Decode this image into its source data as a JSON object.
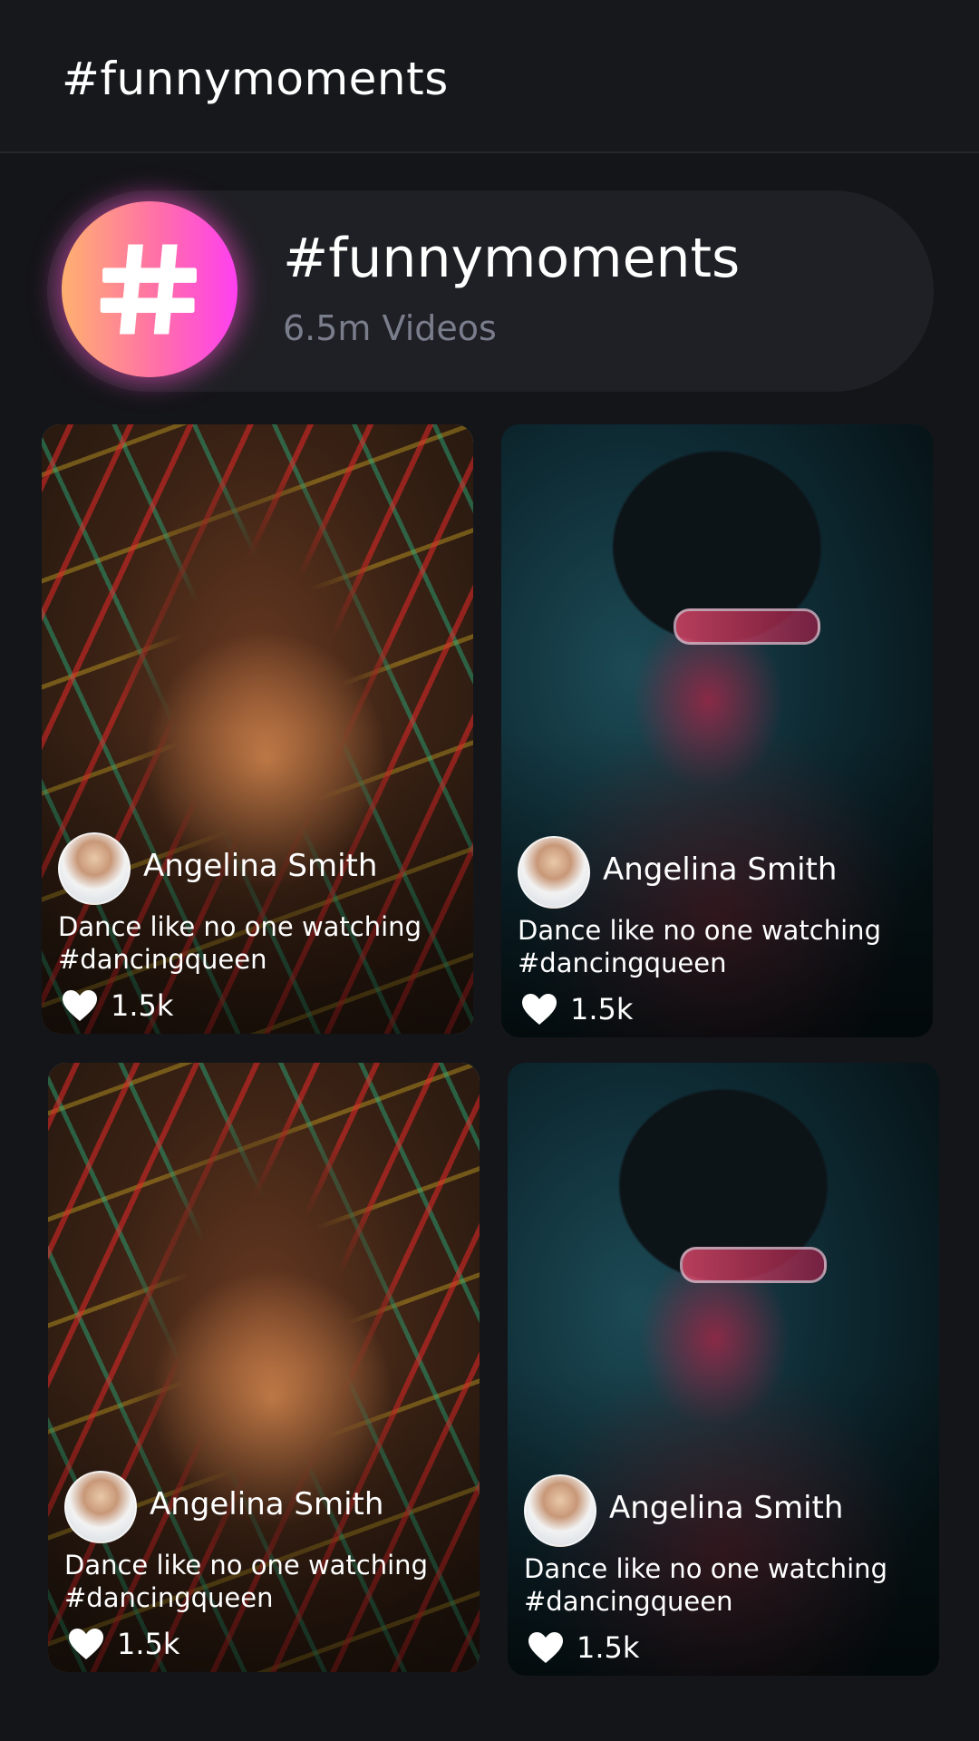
{
  "header": {
    "title": "#funnymoments"
  },
  "hashtag": {
    "icon": "hashtag-icon",
    "name": "#funnymoments",
    "video_count": "6.5m Videos",
    "gradient_colors": [
      "#ffb070",
      "#ff6fa8",
      "#ff3ff0"
    ]
  },
  "videos": [
    {
      "user": "Angelina Smith",
      "caption": "Dance like no one watching #dancingqueen",
      "likes": "1.5k"
    },
    {
      "user": "Angelina Smith",
      "caption": "Dance like no one watching #dancingqueen",
      "likes": "1.5k"
    },
    {
      "user": "Angelina Smith",
      "caption": "Dance like no one watching #dancingqueen",
      "likes": "1.5k"
    },
    {
      "user": "Angelina Smith",
      "caption": "Dance like no one watching #dancingqueen",
      "likes": "1.5k"
    }
  ],
  "colors": {
    "background": "#141519",
    "card": "#1f2025",
    "muted_text": "#7a7d8c"
  }
}
